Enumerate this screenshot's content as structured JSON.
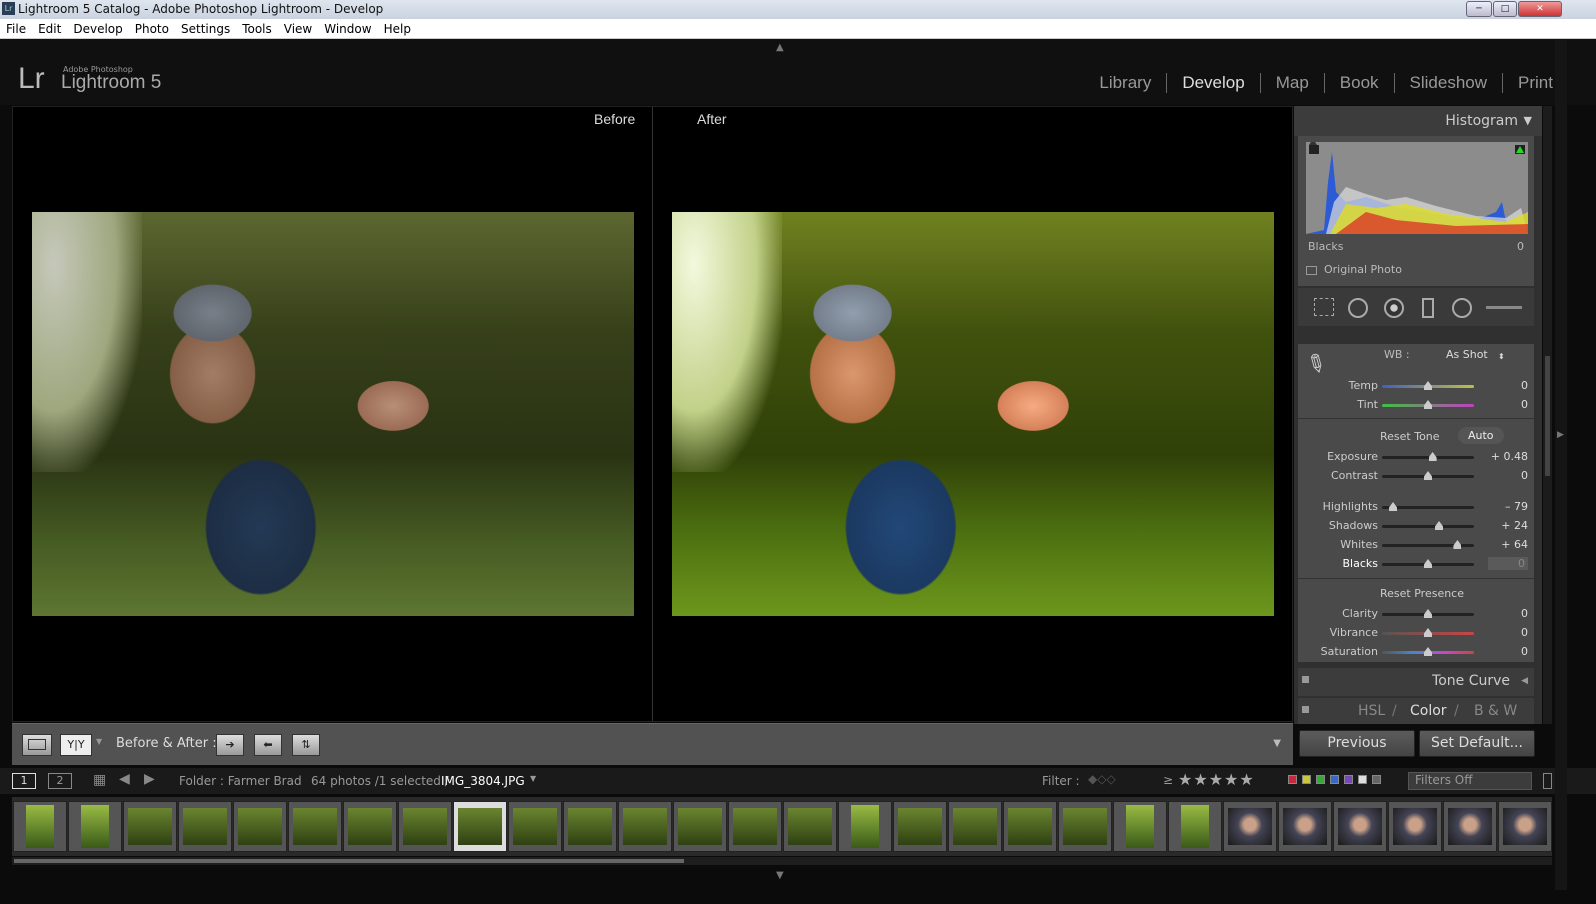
{
  "window": {
    "title": "Lightroom 5 Catalog - Adobe Photoshop Lightroom - Develop",
    "icon": "Lr"
  },
  "menu": [
    "File",
    "Edit",
    "Develop",
    "Photo",
    "Settings",
    "Tools",
    "View",
    "Window",
    "Help"
  ],
  "logo": {
    "mark": "Lr",
    "small": "Adobe Photoshop",
    "name": "Lightroom 5"
  },
  "modules": [
    "Library",
    "Develop",
    "Map",
    "Book",
    "Slideshow",
    "Print"
  ],
  "view": {
    "before_label": "Before",
    "after_label": "After"
  },
  "histogram": {
    "title": "Histogram",
    "readout_label": "Blacks",
    "readout_value": "0",
    "original_photo": "Original Photo"
  },
  "basic": {
    "wb_label": "WB :",
    "wb_value": "As Shot",
    "reset_tone": "Reset Tone",
    "auto": "Auto",
    "reset_presence": "Reset Presence",
    "sliders": [
      {
        "name": "Temp",
        "value": "0",
        "pos": 0.5
      },
      {
        "name": "Tint",
        "value": "0",
        "pos": 0.5
      },
      {
        "name": "Exposure",
        "value": "+ 0.48",
        "pos": 0.55
      },
      {
        "name": "Contrast",
        "value": "0",
        "pos": 0.5
      },
      {
        "name": "Highlights",
        "value": "– 79",
        "pos": 0.12
      },
      {
        "name": "Shadows",
        "value": "+ 24",
        "pos": 0.62
      },
      {
        "name": "Whites",
        "value": "+ 64",
        "pos": 0.82
      },
      {
        "name": "Blacks",
        "value": "0",
        "pos": 0.5
      },
      {
        "name": "Clarity",
        "value": "0",
        "pos": 0.5
      },
      {
        "name": "Vibrance",
        "value": "0",
        "pos": 0.5
      },
      {
        "name": "Saturation",
        "value": "0",
        "pos": 0.5
      }
    ]
  },
  "panels": {
    "tone_curve": "Tone Curve",
    "hsl": "HSL",
    "color": "Color",
    "bw": "B & W"
  },
  "buttons": {
    "previous": "Previous",
    "set_default": "Set Default..."
  },
  "toolbar": {
    "yy": "Y|Y",
    "before_after": "Before & After :"
  },
  "filmstrip": {
    "page1": "1",
    "page2": "2",
    "folder": "Folder : Farmer Brad",
    "count": "64 photos /1 selected /",
    "file": "IMG_3804.JPG",
    "filter_label": "Filter :",
    "ge": "≥",
    "stars": "★★★★★",
    "filters_off": "Filters Off"
  },
  "colors": {
    "labels": [
      "#c8283c",
      "#c8c838",
      "#38a838",
      "#3868c8",
      "#7848b8",
      "#dddddd",
      "#666666"
    ]
  }
}
